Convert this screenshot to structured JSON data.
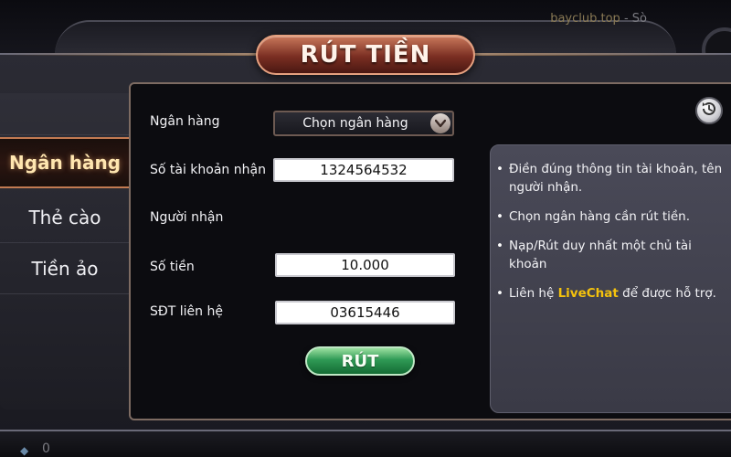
{
  "watermark": {
    "site": "bayclub.top",
    "separator": " - ",
    "suffix": "Sò"
  },
  "title": "RÚT TIỀN",
  "sidebar": {
    "tabs": [
      {
        "label": "Ngân hàng",
        "active": true
      },
      {
        "label": "Thẻ cào",
        "active": false
      },
      {
        "label": "Tiền ảo",
        "active": false
      }
    ]
  },
  "form": {
    "bank_label": "Ngân hàng",
    "bank_select_value": "Chọn ngân hàng",
    "account_label": "Số tài khoản nhận",
    "account_value": "1324564532",
    "recipient_label": "Người nhận",
    "amount_label": "Số tiền",
    "amount_value": "10.000",
    "phone_label": "SĐT liên hệ",
    "phone_value": "03615446",
    "submit_label": "RÚT"
  },
  "info": {
    "items": [
      "Điền đúng thông tin tài khoản, tên người nhận.",
      "Chọn ngân hàng cần rút tiền.",
      "Nạp/Rút duy nhất một chủ tài khoản"
    ],
    "contact_prefix": "Liên hệ ",
    "contact_link": "LiveChat",
    "contact_suffix": " để được hỗ trợ."
  },
  "footer": {
    "balance": "0"
  },
  "colors": {
    "accent_gold": "#f4c20d",
    "title_red": "#7a2e22",
    "submit_green": "#2f9a55"
  },
  "icons": {
    "select": "chevron-down-icon",
    "history": "history-icon",
    "balance": "gem-icon"
  }
}
